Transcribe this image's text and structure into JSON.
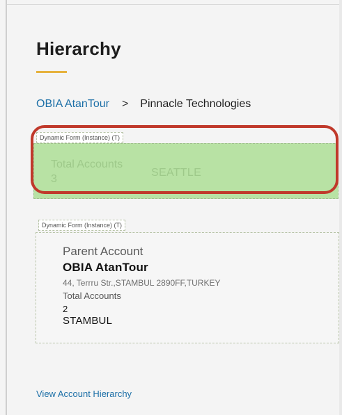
{
  "page": {
    "title": "Hierarchy"
  },
  "breadcrumb": {
    "parent": "OBIA AtanTour",
    "separator": ">",
    "current": "Pinnacle Technologies"
  },
  "highlighted_card": {
    "form_tag": "Dynamic Form (Instance) (T)",
    "total_accounts_label": "Total Accounts",
    "total_accounts_value": "3",
    "city": "SEATTLE"
  },
  "parent_card": {
    "form_tag": "Dynamic Form (Instance) (T)",
    "parent_account_label": "Parent Account",
    "parent_account_name": "OBIA AtanTour",
    "address": "44, Terrru Str.,STAMBUL 2890FF,TURKEY",
    "total_accounts_label": "Total Accounts",
    "total_accounts_value": "2",
    "city": "STAMBUL"
  },
  "footer": {
    "view_hierarchy_link": "View Account Hierarchy"
  },
  "colors": {
    "accent_underline": "#e6b23e",
    "link": "#1c6fa7",
    "highlight_border": "#c0392b",
    "selected_card_bg": "#b8e2a4"
  }
}
